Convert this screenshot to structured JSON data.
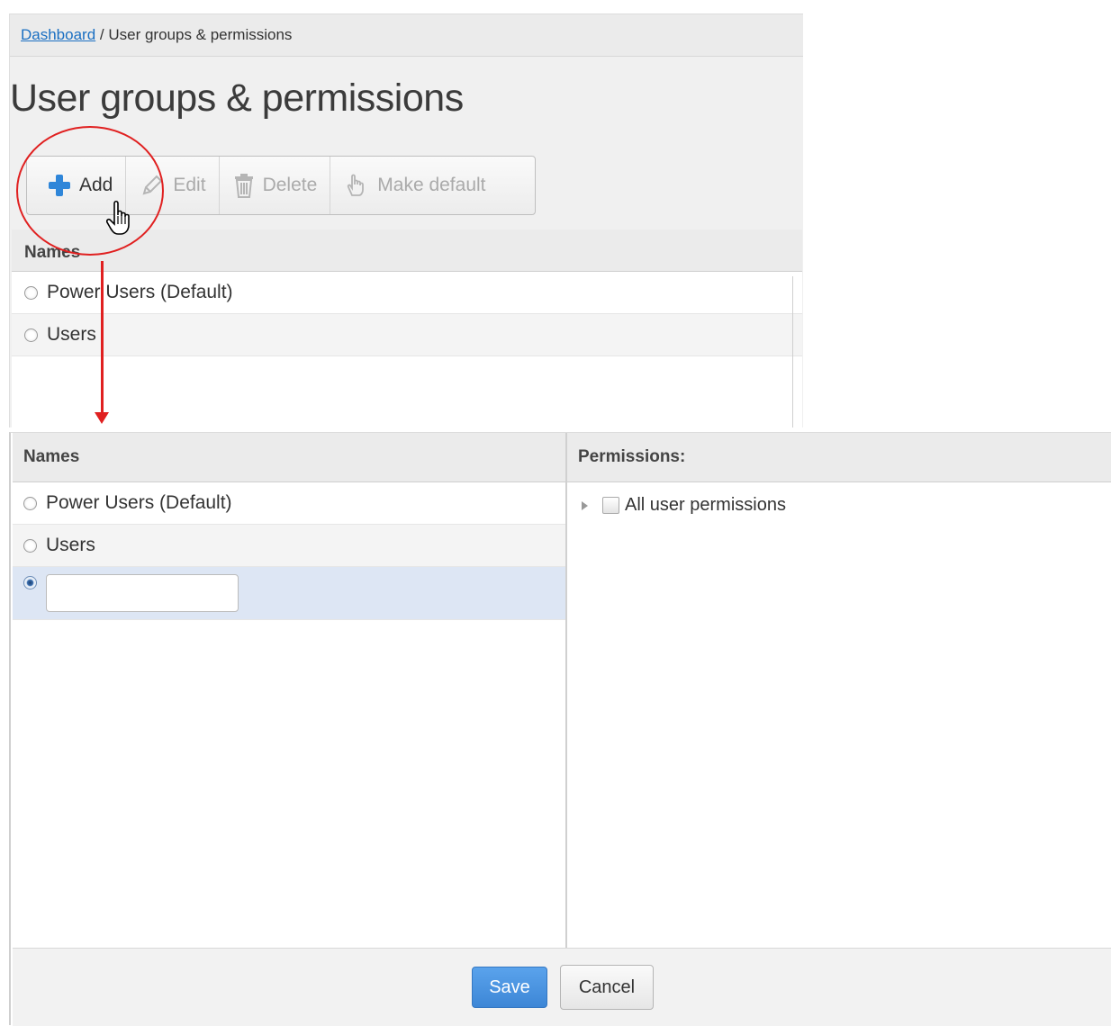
{
  "breadcrumb": {
    "link": "Dashboard",
    "separator": " / ",
    "current": "User groups & permissions"
  },
  "page_title": "User groups & permissions",
  "toolbar": {
    "add": "Add",
    "edit": "Edit",
    "delete": "Delete",
    "make_default": "Make default"
  },
  "grid_top": {
    "header": "Names",
    "rows": [
      "Power Users (Default)",
      "Users"
    ]
  },
  "grid_bottom": {
    "names_header": "Names",
    "permissions_header": "Permissions:",
    "rows": [
      "Power Users (Default)",
      "Users"
    ],
    "new_row_value": "",
    "permission_items": [
      "All user permissions"
    ]
  },
  "footer": {
    "save": "Save",
    "cancel": "Cancel"
  },
  "colors": {
    "accent": "#3d86d6",
    "annotation": "#e02020",
    "link": "#1a6fc2",
    "selected_row": "#dde6f4"
  }
}
